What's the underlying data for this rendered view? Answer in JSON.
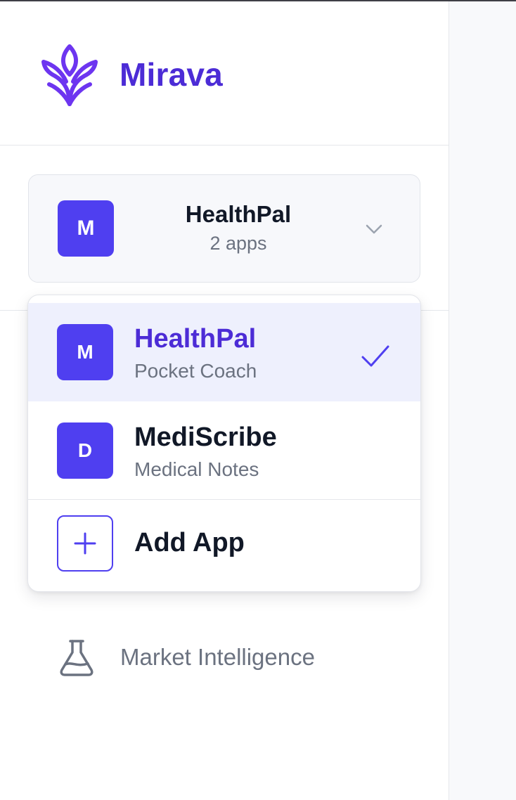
{
  "brand": {
    "name": "Mirava",
    "logo_icon": "lotus-logo-icon",
    "color": "#4c2cd6"
  },
  "app_selector": {
    "current_name": "HealthPal",
    "current_avatar": "M",
    "app_count": "2 apps",
    "chevron_icon": "chevron-down-icon"
  },
  "dropdown": {
    "items": [
      {
        "avatar": "M",
        "name": "HealthPal",
        "subtitle": "Pocket Coach",
        "selected": true
      },
      {
        "avatar": "D",
        "name": "MediScribe",
        "subtitle": "Medical Notes",
        "selected": false
      }
    ],
    "add_label": "Add App",
    "check_icon": "check-icon",
    "add_icon": "plus-icon"
  },
  "nav": {
    "items": [
      {
        "label": "Market Intelligence",
        "icon": "flask-icon"
      }
    ]
  },
  "colors": {
    "accent": "#4f3ff0",
    "selected_bg": "#eef0fd",
    "muted_text": "#6b7280"
  }
}
